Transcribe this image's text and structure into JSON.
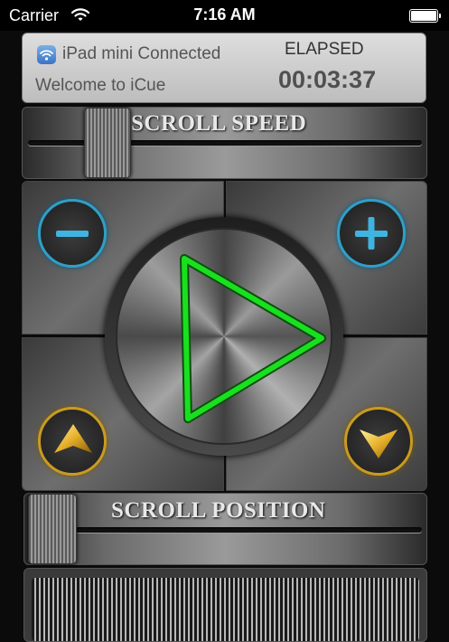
{
  "status_bar": {
    "carrier": "Carrier",
    "time": "7:16 AM"
  },
  "info_panel": {
    "connection": "iPad mini Connected",
    "welcome": "Welcome to iCue",
    "elapsed_label": "ELAPSED",
    "elapsed_time": "00:03:37"
  },
  "scroll_speed": {
    "label": "SCROLL SPEED",
    "value": 0.2
  },
  "scroll_position": {
    "label": "SCROLL POSITION",
    "value": 0.0
  },
  "controls": {
    "decrease_icon": "minus-icon",
    "increase_icon": "plus-icon",
    "play_icon": "play-icon",
    "up_icon": "arrow-up-icon",
    "down_icon": "arrow-down-icon"
  },
  "colors": {
    "play_green": "#19e01e",
    "blue_ring": "#2f9fc8",
    "gold_ring": "#c99b22"
  }
}
